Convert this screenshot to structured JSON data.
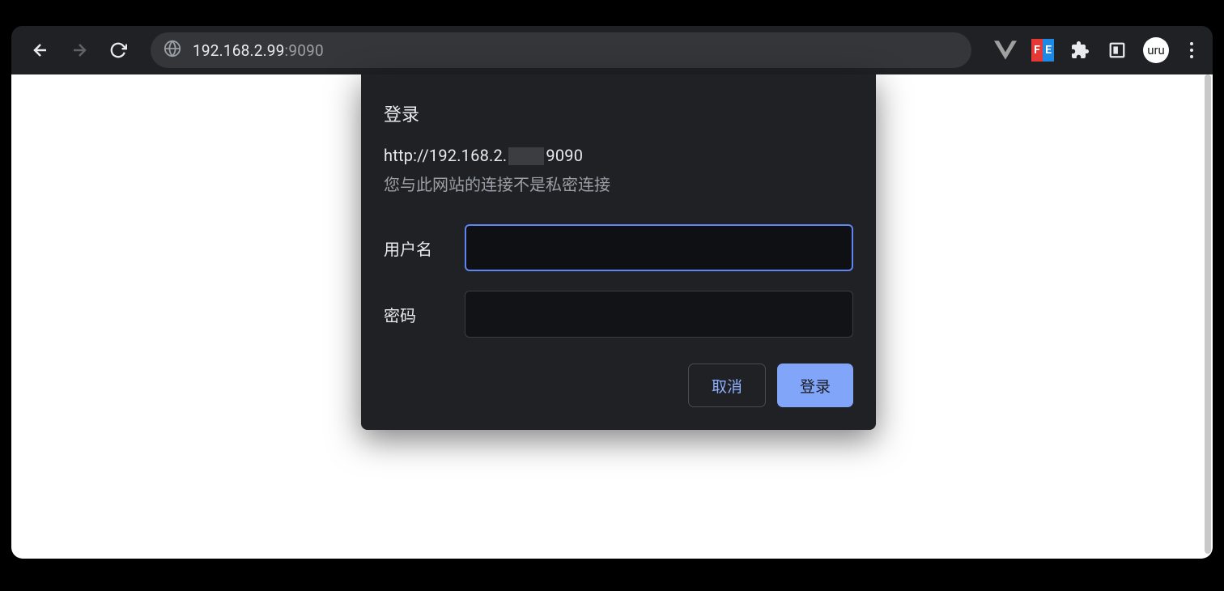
{
  "toolbar": {
    "url_host": "192.168.2.99",
    "url_port": ":9090",
    "avatar_label": "uru"
  },
  "dialog": {
    "title": "登录",
    "url_prefix": "http://192.168.2.",
    "url_suffix": "9090",
    "warning": "您与此网站的连接不是私密连接",
    "username_label": "用户名",
    "password_label": "密码",
    "cancel_label": "取消",
    "submit_label": "登录"
  }
}
